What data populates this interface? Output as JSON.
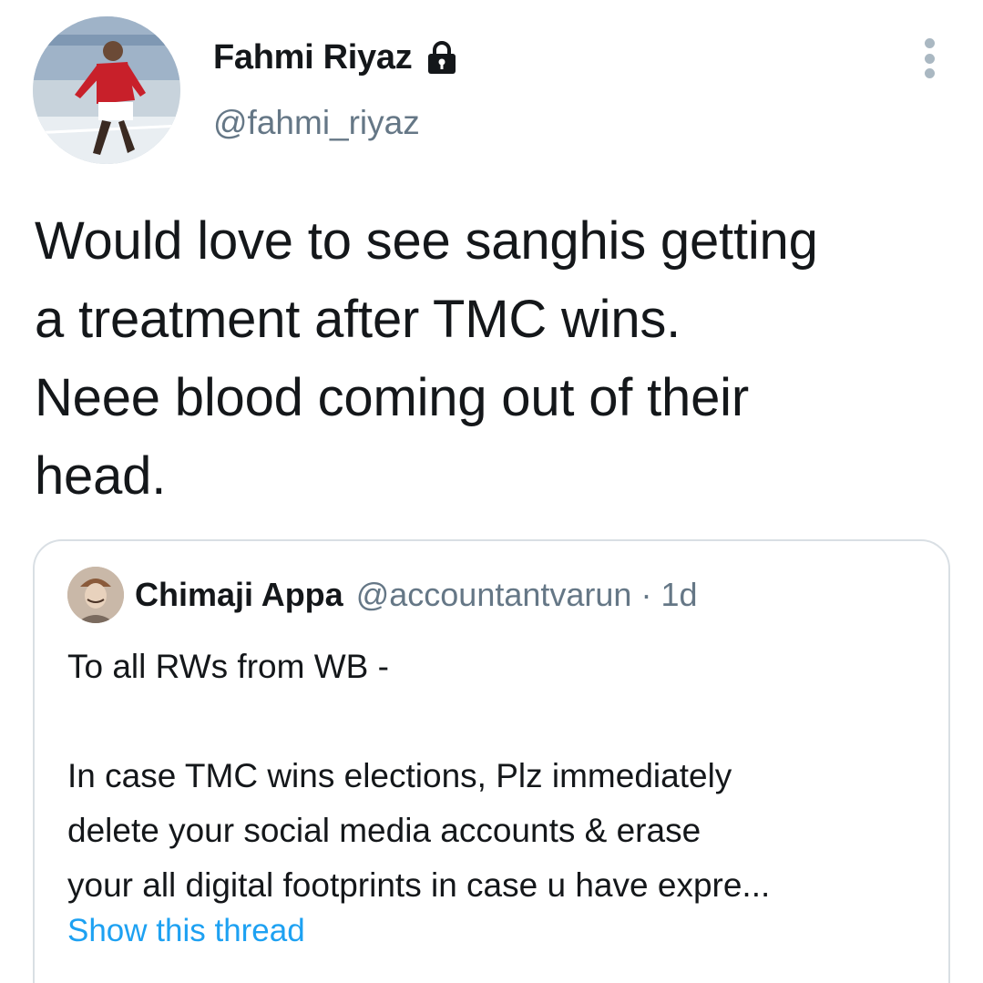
{
  "author": {
    "display_name": "Fahmi Riyaz",
    "handle": "@fahmi_riyaz",
    "avatar_icon": "profile-photo",
    "protected_icon": "lock-icon"
  },
  "tweet": {
    "lines": [
      "Would love to see sanghis getting",
      "a treatment after TMC wins.",
      "Neee blood coming out of their",
      "head."
    ]
  },
  "menu": {
    "icon": "more-vertical-icon"
  },
  "quoted_tweet": {
    "author_name": "Chimaji Appa",
    "author_handle": "@accountantvarun",
    "separator": "·",
    "time": "1d",
    "avatar_icon": "profile-photo",
    "intro": "To all RWs from WB -",
    "body_lines": [
      "In case TMC wins elections, Plz immediately",
      "delete your social media accounts & erase",
      "your all digital footprints in case u have expre..."
    ],
    "show_thread_label": "Show this thread"
  },
  "colors": {
    "text_primary": "#14171a",
    "text_secondary": "#657786",
    "link": "#1da1f2",
    "border": "#d9dfe4"
  }
}
